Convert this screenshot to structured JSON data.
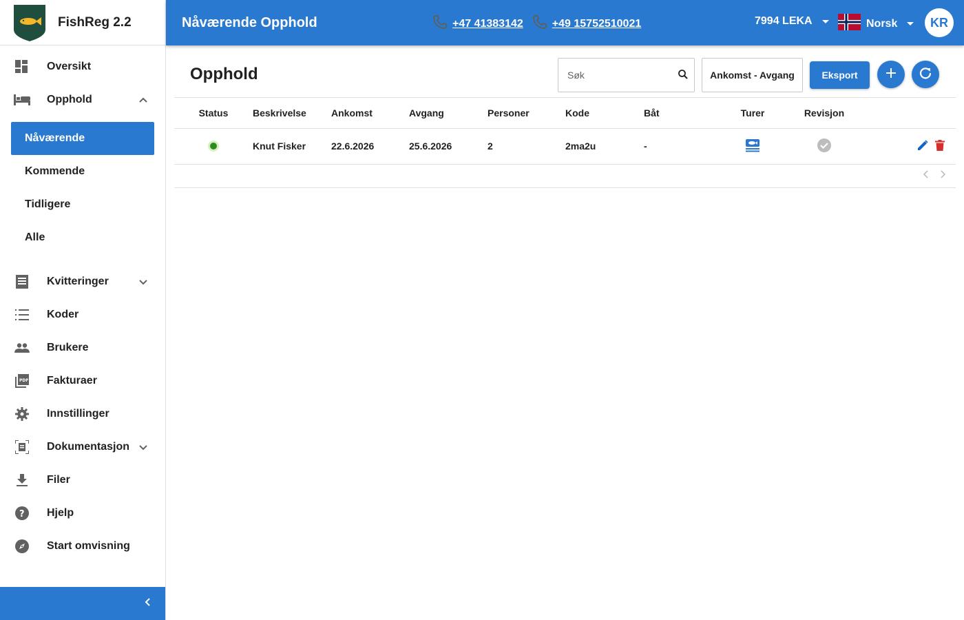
{
  "brand": {
    "title": "FishReg 2.2"
  },
  "sidebar": {
    "items_top": [
      {
        "label": "Oversikt",
        "icon": "dashboard-icon"
      },
      {
        "label": "Opphold",
        "icon": "bed-icon"
      }
    ],
    "sub_items": [
      {
        "label": "Nåværende",
        "active": true
      },
      {
        "label": "Kommende"
      },
      {
        "label": "Tidligere"
      },
      {
        "label": "Alle"
      }
    ],
    "items_bottom": [
      {
        "label": "Kvitteringer",
        "icon": "receipt-icon"
      },
      {
        "label": "Koder",
        "icon": "list-icon"
      },
      {
        "label": "Brukere",
        "icon": "people-icon"
      },
      {
        "label": "Fakturaer",
        "icon": "pdf-icon"
      },
      {
        "label": "Innstillinger",
        "icon": "gear-icon"
      },
      {
        "label": "Dokumentasjon",
        "icon": "document-icon"
      },
      {
        "label": "Filer",
        "icon": "download-icon"
      },
      {
        "label": "Hjelp",
        "icon": "help-icon"
      },
      {
        "label": "Start omvisning",
        "icon": "compass-icon"
      }
    ]
  },
  "header": {
    "title": "Nåværende Opphold",
    "phone1": "+47 41383142",
    "phone2": "+49 15752510021",
    "location": "7994 LEKA",
    "language": "Norsk",
    "avatar_initials": "KR"
  },
  "main": {
    "title": "Opphold",
    "search_placeholder": "Søk",
    "range_label": "Ankomst - Avgang",
    "export_label": "Eksport"
  },
  "table": {
    "columns": [
      "Status",
      "Beskrivelse",
      "Ankomst",
      "Avgang",
      "Personer",
      "Kode",
      "Båt",
      "Turer",
      "Revisjon",
      ""
    ],
    "rows": [
      {
        "status": "active",
        "description": "Knut Fisker",
        "arrival": "22.6.2026",
        "departure": "25.6.2026",
        "persons": "2",
        "code": "2ma2u",
        "boat": "-"
      }
    ]
  },
  "colors": {
    "primary": "#2979d1",
    "status_active": "#2e8b1f",
    "delete": "#d32f2f"
  }
}
